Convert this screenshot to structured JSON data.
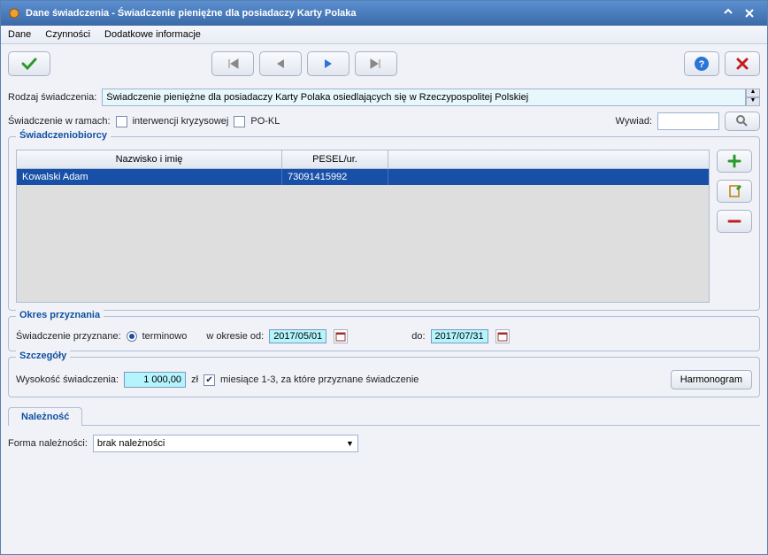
{
  "title": "Dane świadczenia - Świadczenie pieniężne dla posiadaczy Karty Polaka",
  "menu": {
    "dane": "Dane",
    "czynnosci": "Czynności",
    "dodatkowe": "Dodatkowe informacje"
  },
  "form": {
    "rodzaj_label": "Rodzaj świadczenia:",
    "rodzaj_value": "Świadczenie pieniężne dla posiadaczy Karty Polaka osiedlających się w Rzeczypospolitej Polskiej",
    "swiadczenie_ramach_label": "Świadczenie w ramach:",
    "chk_interwencji_label": "interwencji kryzysowej",
    "chk_pokl_label": "PO-KL",
    "wywiad_label": "Wywiad:"
  },
  "group1": {
    "legend": "Świadczeniobiorcy",
    "cols": {
      "name": "Nazwisko i imię",
      "pesel": "PESEL/ur."
    },
    "rows": [
      {
        "name": "Kowalski Adam",
        "pesel": "73091415992"
      }
    ]
  },
  "group2": {
    "legend": "Okres przyznania",
    "przyznane_label": "Świadczenie przyznane:",
    "terminowo_label": "terminowo",
    "okres_od_label": "w okresie od:",
    "date_from": "2017/05/01",
    "do_label": "do:",
    "date_to": "2017/07/31"
  },
  "group3": {
    "legend": "Szczegóły",
    "wysokosc_label": "Wysokość świadczenia:",
    "amount": "1 000,00",
    "currency": "zł",
    "miesiace_label": "miesiące 1-3, za które przyznane świadczenie",
    "harmonogram_label": "Harmonogram"
  },
  "tabs": {
    "naleznosc": "Należność"
  },
  "naleznosc": {
    "forma_label": "Forma należności:",
    "forma_value": "brak należności"
  },
  "colors": {
    "accent": "#3c6aa8",
    "highlight_bg": "#b4f4fc",
    "selected_row": "#1850a8"
  }
}
